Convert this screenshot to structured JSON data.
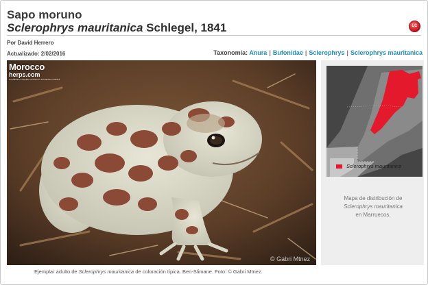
{
  "header": {
    "common_name": "Sapo moruno",
    "scientific_name": "Sclerophrys mauritanica",
    "authority": "Schlegel, 1841",
    "status_badge": "LC"
  },
  "meta": {
    "author": "Por David Herrero",
    "updated": "Actualizado: 2/02/2016"
  },
  "taxonomy": {
    "label": "Taxonomía:",
    "separator": "|",
    "links": [
      "Anura",
      "Bufonidae",
      "Sclerophrys",
      "Sclerophrys mauritanica"
    ]
  },
  "photo": {
    "logo_main": "Morocco",
    "logo_sub": "herps.com",
    "logo_tiny": "Amphibians & Reptiles of Morocco and Western Sahara",
    "watermark": "© Gabri Mtnez",
    "caption_prefix": "Ejemplar adulto de",
    "caption_species": "Sclerophrys mauritanica",
    "caption_suffix": "de coloración típica. Ben-Slimane. Foto: © Gabri Mtnez."
  },
  "map": {
    "legend_label": "Sclerophrys mauritanica",
    "note_line1": "Mapa de distribución de",
    "note_species": "Sclerophrys mauritanica",
    "note_line3": "en Marruecos."
  },
  "colors": {
    "link": "#1f8fb8",
    "distribution_red": "#e41a2c",
    "badge_red": "#c0121c"
  }
}
